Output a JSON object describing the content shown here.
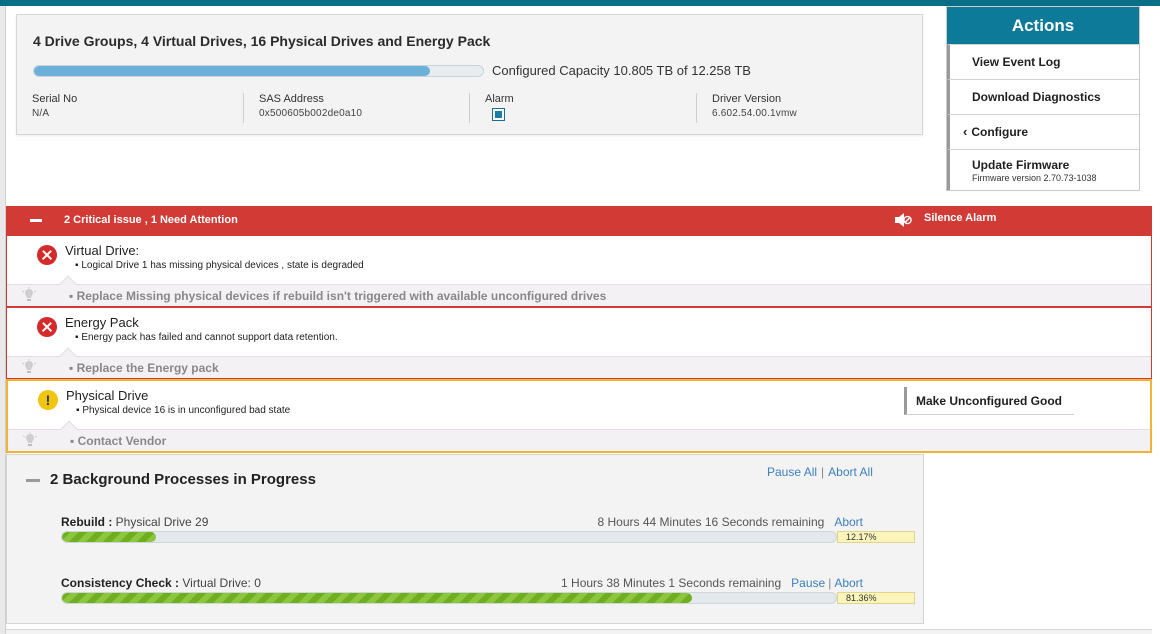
{
  "summary": {
    "title": "4 Drive Groups, 4 Virtual Drives, 16 Physical Drives and Energy Pack",
    "capacity_text": "Configured Capacity 10.805 TB of 12.258 TB",
    "capacity_fraction": 0.881,
    "fields": {
      "serial": {
        "label": "Serial No",
        "value": "N/A"
      },
      "sas": {
        "label": "SAS Address",
        "value": "0x500605b002de0a10"
      },
      "alarm": {
        "label": "Alarm",
        "checked": true
      },
      "driver": {
        "label": "Driver Version",
        "value": "6.602.54.00.1vmw"
      }
    }
  },
  "actions": {
    "title": "Actions",
    "view_event_log": "View Event Log",
    "download_diagnostics": "Download Diagnostics",
    "configure": "Configure",
    "update_firmware": "Update Firmware",
    "firmware_version": "Firmware version 2.70.73-1038"
  },
  "banner": {
    "message": "2 Critical issue , 1 Need Attention",
    "silence": "Silence Alarm",
    "color": "#d23a36"
  },
  "issues": [
    {
      "title": "Virtual Drive:",
      "detail": "Logical Drive 1 has missing physical devices , state is degraded",
      "suggestion": "Replace Missing physical devices if rebuild isn't triggered with available unconfigured drives",
      "severity": "critical"
    },
    {
      "title": "Energy Pack",
      "detail": "Energy pack has failed and cannot support data retention.",
      "suggestion": "Replace the Energy pack",
      "severity": "critical"
    },
    {
      "title": "Physical Drive",
      "detail": "Physical device 16 is in unconfigured bad state",
      "suggestion": "Contact Vendor",
      "severity": "warning",
      "action": "Make Unconfigured Good"
    }
  ],
  "background": {
    "title": "2 Background Processes in Progress",
    "pause_all": "Pause All",
    "abort_all": "Abort All",
    "processes": [
      {
        "label": "Rebuild :",
        "target": "Physical Drive 29",
        "remaining": "8 Hours 44 Minutes 16 Seconds remaining",
        "abort": "Abort",
        "percent_text": "12.17%",
        "fraction": 0.1217
      },
      {
        "label": "Consistency Check :",
        "target": "Virtual Drive: 0",
        "remaining": "1 Hours 38 Minutes 1 Seconds remaining",
        "pause": "Pause",
        "abort": "Abort",
        "percent_text": "81.36%",
        "fraction": 0.8136
      }
    ]
  }
}
